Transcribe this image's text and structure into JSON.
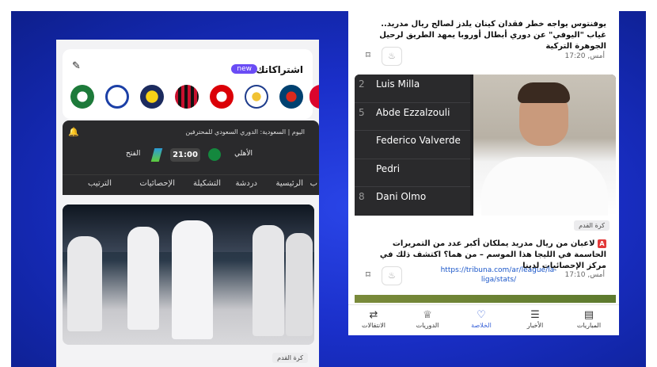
{
  "left_phone": {
    "subscriptions_title": "اشتراكاتك",
    "new_badge": "new",
    "match": {
      "header": "اليوم | السعودية: الدوري السعودي للمحترفين",
      "home_team": "الأهلي",
      "away_team": "الفتح",
      "time": "21:00"
    },
    "tabs": [
      "الرئيسية",
      "دردشة",
      "التشكيلة",
      "الإحصائيات",
      "الترتيب"
    ],
    "tab_partial": "ب",
    "category_tag": "كرة القدم"
  },
  "right_phone": {
    "top_news": "يوفنتوس يواجه خطر فقدان كينان يلدز لصالح ريال مدريد.. غياب \"اليوفي\" عن دوري أبطال أوروبا يمهد الطريق لرحيل الجوهرة التركية",
    "top_time": "أمس, 17:20",
    "lineup": [
      {
        "num": "2",
        "name": "Luis Milla"
      },
      {
        "num": "5",
        "name": "Abde Ezzalzouli"
      },
      {
        "num": "",
        "name": "Federico Valverde"
      },
      {
        "num": "",
        "name": "Pedri"
      },
      {
        "num": "8",
        "name": "Dani Olmo"
      }
    ],
    "category_tag": "كرة القدم",
    "mid_news": "لاعبان من ريال مدريد يملكان أكبر عدد من التمريرات الحاسمة في الليجا هذا الموسم – من هما؟ اكتشف ذلك في مركز الإحصائيات لدينا",
    "red_mark": "A",
    "link": "https://tribuna.com/ar/league/la-liga/stats/",
    "mid_time": "أمس, 17:10",
    "nav": [
      {
        "label": "المباريات",
        "icon": "calendar-icon",
        "active": false
      },
      {
        "label": "الأخبار",
        "icon": "list-icon",
        "active": false
      },
      {
        "label": "الخلاصة",
        "icon": "heart-icon",
        "active": true
      },
      {
        "label": "الدوريات",
        "icon": "trophy-icon",
        "active": false
      },
      {
        "label": "الانتقالات",
        "icon": "transfer-icon",
        "active": false
      }
    ]
  },
  "colors": {
    "background": "#1a2fc9",
    "accent": "#3a63d8",
    "badge": "#6a4cf5"
  }
}
